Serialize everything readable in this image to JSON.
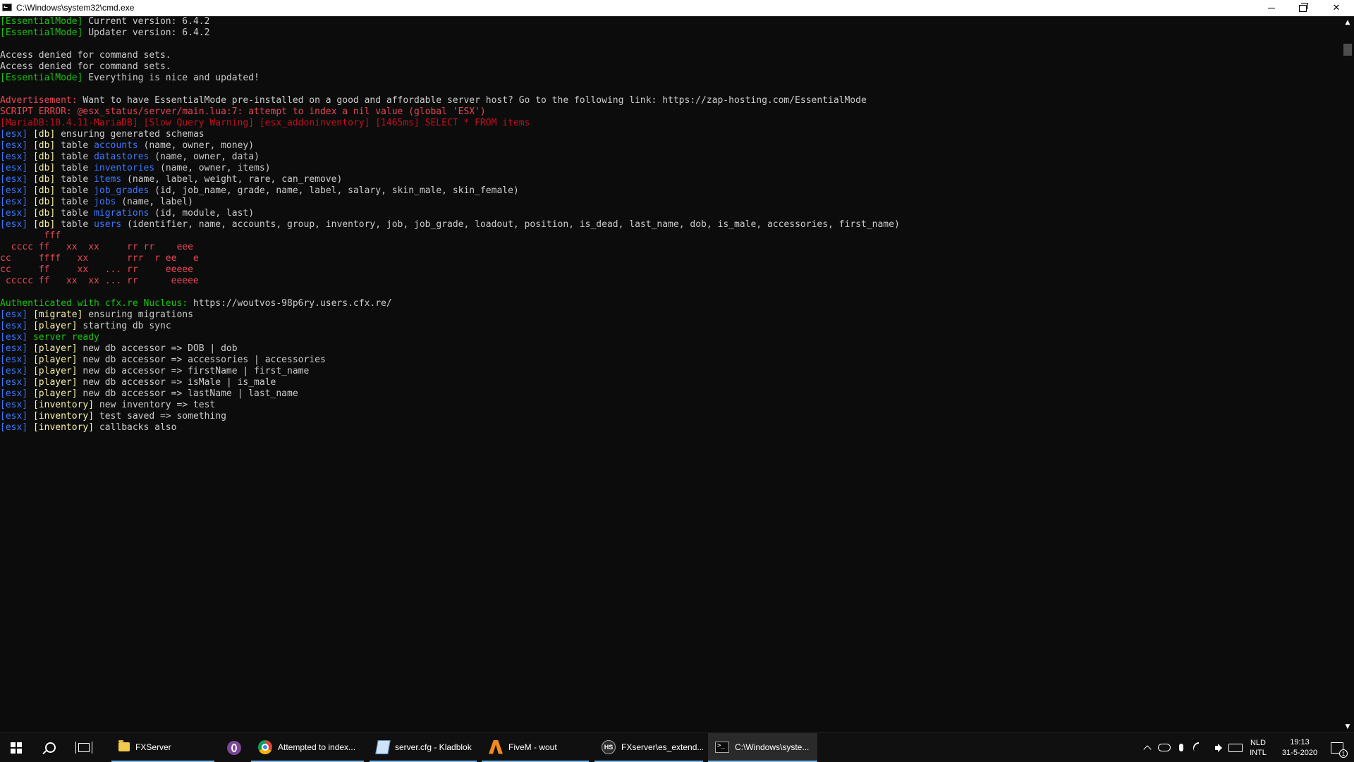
{
  "window": {
    "title": "C:\\Windows\\system32\\cmd.exe"
  },
  "console": {
    "lines": [
      [
        {
          "t": "[EssentialMode]",
          "c": "green"
        },
        {
          "t": " Current version: 6.4.2",
          "c": "white"
        }
      ],
      [
        {
          "t": "[EssentialMode]",
          "c": "green"
        },
        {
          "t": " Updater version: 6.4.2",
          "c": "white"
        }
      ],
      [],
      [
        {
          "t": "Access denied for command sets.",
          "c": "white"
        }
      ],
      [
        {
          "t": "Access denied for command sets.",
          "c": "white"
        }
      ],
      [
        {
          "t": "[EssentialMode]",
          "c": "green"
        },
        {
          "t": " Everything is nice and updated!",
          "c": "white"
        }
      ],
      [],
      [
        {
          "t": "Advertisement:",
          "c": "red"
        },
        {
          "t": " Want to have EssentialMode pre-installed on a good and affordable server host? Go to the following link: https://zap-hosting.com/EssentialMode",
          "c": "white"
        }
      ],
      [
        {
          "t": "SCRIPT ERROR: @esx_status/server/main.lua:7: attempt to index a nil value (global 'ESX')",
          "c": "red"
        }
      ],
      [
        {
          "t": "[MariaDB:10.4.11-MariaDB] [Slow Query Warning] [esx_addoninventory] [1465ms] SELECT * FROM items",
          "c": "dred"
        }
      ],
      [
        {
          "t": "[esx]",
          "c": "blue"
        },
        {
          "t": " ",
          "c": "white"
        },
        {
          "t": "[db]",
          "c": "yellow"
        },
        {
          "t": " ensuring generated schemas",
          "c": "white"
        }
      ],
      [
        {
          "t": "[esx]",
          "c": "blue"
        },
        {
          "t": " ",
          "c": "white"
        },
        {
          "t": "[db]",
          "c": "yellow"
        },
        {
          "t": " table ",
          "c": "white"
        },
        {
          "t": "accounts",
          "c": "blue"
        },
        {
          "t": " (name, owner, money)",
          "c": "white"
        }
      ],
      [
        {
          "t": "[esx]",
          "c": "blue"
        },
        {
          "t": " ",
          "c": "white"
        },
        {
          "t": "[db]",
          "c": "yellow"
        },
        {
          "t": " table ",
          "c": "white"
        },
        {
          "t": "datastores",
          "c": "blue"
        },
        {
          "t": " (name, owner, data)",
          "c": "white"
        }
      ],
      [
        {
          "t": "[esx]",
          "c": "blue"
        },
        {
          "t": " ",
          "c": "white"
        },
        {
          "t": "[db]",
          "c": "yellow"
        },
        {
          "t": " table ",
          "c": "white"
        },
        {
          "t": "inventories",
          "c": "blue"
        },
        {
          "t": " (name, owner, items)",
          "c": "white"
        }
      ],
      [
        {
          "t": "[esx]",
          "c": "blue"
        },
        {
          "t": " ",
          "c": "white"
        },
        {
          "t": "[db]",
          "c": "yellow"
        },
        {
          "t": " table ",
          "c": "white"
        },
        {
          "t": "items",
          "c": "blue"
        },
        {
          "t": " (name, label, weight, rare, can_remove)",
          "c": "white"
        }
      ],
      [
        {
          "t": "[esx]",
          "c": "blue"
        },
        {
          "t": " ",
          "c": "white"
        },
        {
          "t": "[db]",
          "c": "yellow"
        },
        {
          "t": " table ",
          "c": "white"
        },
        {
          "t": "job_grades",
          "c": "blue"
        },
        {
          "t": " (id, job_name, grade, name, label, salary, skin_male, skin_female)",
          "c": "white"
        }
      ],
      [
        {
          "t": "[esx]",
          "c": "blue"
        },
        {
          "t": " ",
          "c": "white"
        },
        {
          "t": "[db]",
          "c": "yellow"
        },
        {
          "t": " table ",
          "c": "white"
        },
        {
          "t": "jobs",
          "c": "blue"
        },
        {
          "t": " (name, label)",
          "c": "white"
        }
      ],
      [
        {
          "t": "[esx]",
          "c": "blue"
        },
        {
          "t": " ",
          "c": "white"
        },
        {
          "t": "[db]",
          "c": "yellow"
        },
        {
          "t": " table ",
          "c": "white"
        },
        {
          "t": "migrations",
          "c": "blue"
        },
        {
          "t": " (id, module, last)",
          "c": "white"
        }
      ],
      [
        {
          "t": "[esx]",
          "c": "blue"
        },
        {
          "t": " ",
          "c": "white"
        },
        {
          "t": "[db]",
          "c": "yellow"
        },
        {
          "t": " table ",
          "c": "white"
        },
        {
          "t": "users",
          "c": "blue"
        },
        {
          "t": " (identifier, name, accounts, group, inventory, job, job_grade, loadout, position, is_dead, last_name, dob, is_male, accessories, first_name)",
          "c": "white"
        }
      ],
      [
        {
          "t": "        fff",
          "c": "red"
        }
      ],
      [
        {
          "t": "  cccc ff   xx  xx     rr rr    eee",
          "c": "red"
        }
      ],
      [
        {
          "t": "cc     ffff   xx       rrr  r ee   e",
          "c": "red"
        }
      ],
      [
        {
          "t": "cc     ff     xx   ... rr     eeeee",
          "c": "red"
        }
      ],
      [
        {
          "t": " ccccc ff   xx  xx ... rr      eeeee",
          "c": "red"
        }
      ],
      [],
      [
        {
          "t": "Authenticated with cfx.re Nucleus:",
          "c": "green"
        },
        {
          "t": " https://woutvos-98p6ry.users.cfx.re/",
          "c": "white"
        }
      ],
      [
        {
          "t": "[esx]",
          "c": "blue"
        },
        {
          "t": " ",
          "c": "white"
        },
        {
          "t": "[migrate]",
          "c": "yellow"
        },
        {
          "t": " ensuring migrations",
          "c": "white"
        }
      ],
      [
        {
          "t": "[esx]",
          "c": "blue"
        },
        {
          "t": " ",
          "c": "white"
        },
        {
          "t": "[player]",
          "c": "yellow"
        },
        {
          "t": " starting db sync",
          "c": "white"
        }
      ],
      [
        {
          "t": "[esx]",
          "c": "blue"
        },
        {
          "t": " server ready",
          "c": "green"
        }
      ],
      [
        {
          "t": "[esx]",
          "c": "blue"
        },
        {
          "t": " ",
          "c": "white"
        },
        {
          "t": "[player]",
          "c": "yellow"
        },
        {
          "t": " new db accessor => DOB | dob",
          "c": "white"
        }
      ],
      [
        {
          "t": "[esx]",
          "c": "blue"
        },
        {
          "t": " ",
          "c": "white"
        },
        {
          "t": "[player]",
          "c": "yellow"
        },
        {
          "t": " new db accessor => accessories | accessories",
          "c": "white"
        }
      ],
      [
        {
          "t": "[esx]",
          "c": "blue"
        },
        {
          "t": " ",
          "c": "white"
        },
        {
          "t": "[player]",
          "c": "yellow"
        },
        {
          "t": " new db accessor => firstName | first_name",
          "c": "white"
        }
      ],
      [
        {
          "t": "[esx]",
          "c": "blue"
        },
        {
          "t": " ",
          "c": "white"
        },
        {
          "t": "[player]",
          "c": "yellow"
        },
        {
          "t": " new db accessor => isMale | is_male",
          "c": "white"
        }
      ],
      [
        {
          "t": "[esx]",
          "c": "blue"
        },
        {
          "t": " ",
          "c": "white"
        },
        {
          "t": "[player]",
          "c": "yellow"
        },
        {
          "t": " new db accessor => lastName | last_name",
          "c": "white"
        }
      ],
      [
        {
          "t": "[esx]",
          "c": "blue"
        },
        {
          "t": " ",
          "c": "white"
        },
        {
          "t": "[inventory]",
          "c": "yellow"
        },
        {
          "t": " new inventory => test",
          "c": "white"
        }
      ],
      [
        {
          "t": "[esx]",
          "c": "blue"
        },
        {
          "t": " ",
          "c": "white"
        },
        {
          "t": "[inventory]",
          "c": "yellow"
        },
        {
          "t": " test saved => something",
          "c": "white"
        }
      ],
      [
        {
          "t": "[esx]",
          "c": "blue"
        },
        {
          "t": " ",
          "c": "white"
        },
        {
          "t": "[inventory]",
          "c": "yellow"
        },
        {
          "t": " callbacks also",
          "c": "white"
        }
      ]
    ]
  },
  "taskbar": {
    "apps": [
      {
        "name": "taskbar-app-fxserver",
        "icon": "folder-icon",
        "icon_class": "ico-folder",
        "label": "FXServer",
        "state": "running"
      },
      {
        "name": "taskbar-app-tor",
        "icon": "tor-browser-icon",
        "icon_class": "ico-tor",
        "label": "",
        "state": "pinned"
      },
      {
        "name": "taskbar-app-chrome",
        "icon": "chrome-icon",
        "icon_class": "ico-chrome",
        "label": "Attempted to index...",
        "state": "running"
      },
      {
        "name": "taskbar-app-notepad",
        "icon": "notepad-icon",
        "icon_class": "ico-notepad",
        "label": "server.cfg - Kladblok",
        "state": "running"
      },
      {
        "name": "taskbar-app-fivem",
        "icon": "fivem-icon",
        "icon_class": "ico-fivem",
        "label": "FiveM - wout",
        "state": "running"
      },
      {
        "name": "taskbar-app-hs",
        "icon": "hs-icon",
        "icon_class": "ico-hs",
        "icon_text": "HS",
        "label": "FXserver\\es_extend...",
        "state": "running"
      },
      {
        "name": "taskbar-app-cmd",
        "icon": "cmd-icon",
        "icon_class": "ico-cmd",
        "label": "C:\\Windows\\syste...",
        "state": "current"
      }
    ],
    "tray": {
      "lang_line1": "NLD",
      "lang_line2": "INTL",
      "time": "19:13",
      "date": "31-5-2020",
      "notification_count": "1"
    }
  },
  "colors": {
    "green": "#16c60c",
    "blue": "#3b78ff",
    "yellow": "#f9f1a5",
    "red": "#e74856",
    "dred": "#c50f1f",
    "white": "#cccccc",
    "console_bg": "#0c0c0c",
    "taskbar_bg": "#101010",
    "accent": "#76b9ed"
  }
}
